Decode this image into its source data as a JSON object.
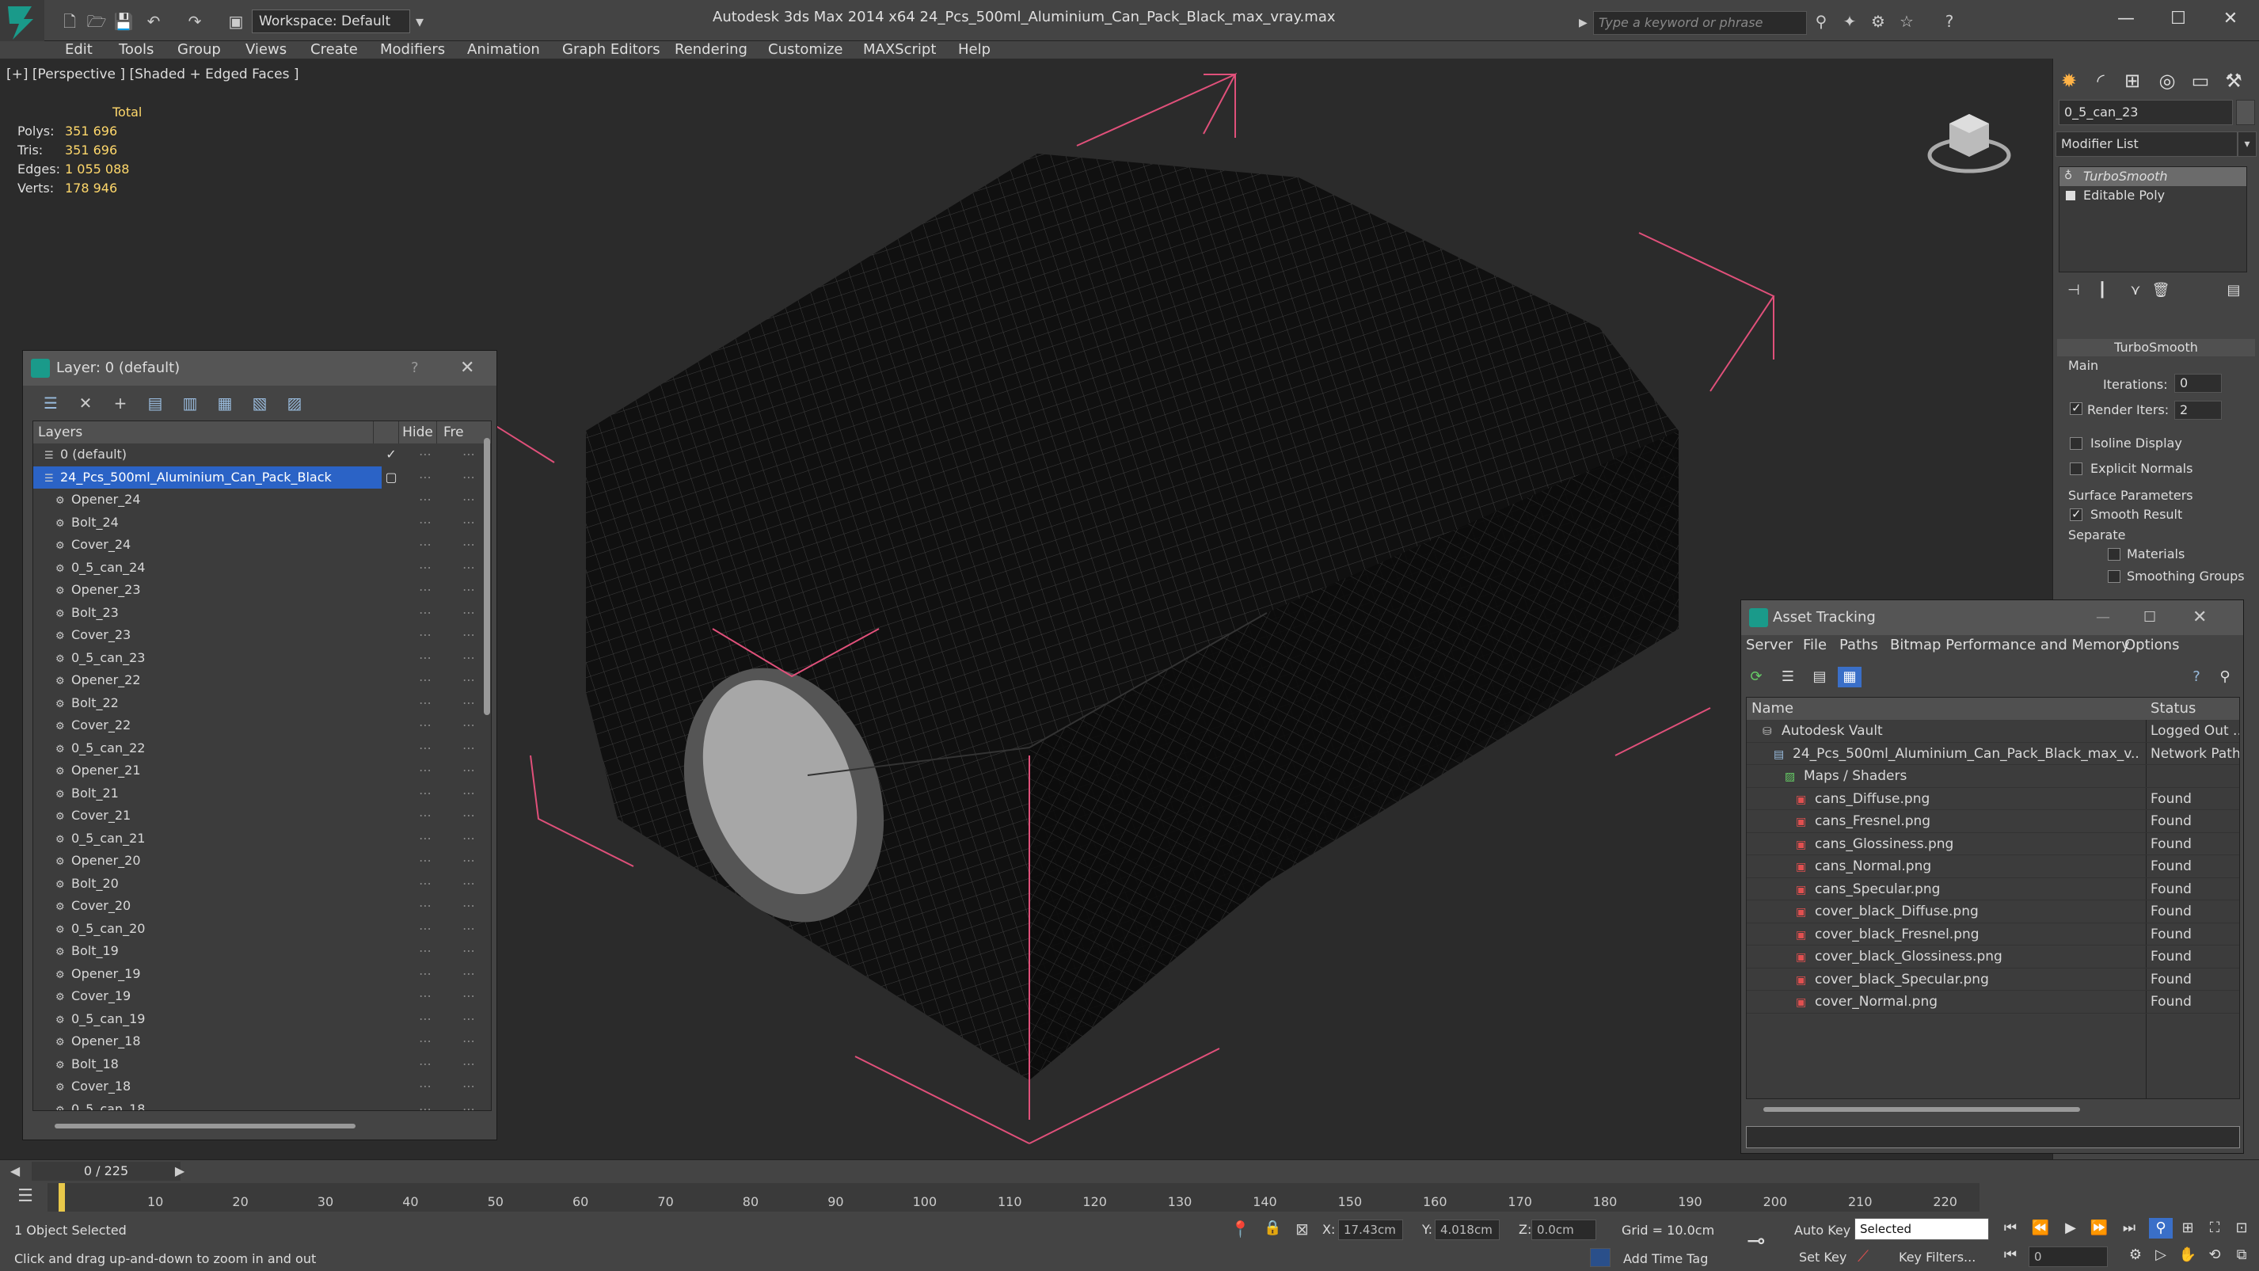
{
  "app": {
    "title": "Autodesk 3ds Max  2014 x64     24_Pcs_500ml_Aluminium_Can_Pack_Black_max_vray.max",
    "workspace": "Workspace: Default",
    "search_placeholder": "Type a keyword or phrase"
  },
  "menu": [
    "Edit",
    "Tools",
    "Group",
    "Views",
    "Create",
    "Modifiers",
    "Animation",
    "Graph Editors",
    "Rendering",
    "Customize",
    "MAXScript",
    "Help"
  ],
  "viewport": {
    "label": "[+] [Perspective ] [Shaded + Edged Faces ]",
    "stats": {
      "header": "Total",
      "rows": [
        {
          "key": "Polys:",
          "value": "351 696"
        },
        {
          "key": "Tris:",
          "value": "351 696"
        },
        {
          "key": "Edges:",
          "value": "1 055 088"
        },
        {
          "key": "Verts:",
          "value": "178 946"
        }
      ]
    }
  },
  "layer_window": {
    "title": "Layer: 0 (default)",
    "help": "?",
    "headers": {
      "layers": "Layers",
      "hide": "Hide",
      "freeze": "Fre"
    },
    "rows": [
      {
        "name": "0 (default)",
        "level": 1,
        "type": "layer",
        "current": true
      },
      {
        "name": "24_Pcs_500ml_Aluminium_Can_Pack_Black",
        "level": 1,
        "type": "layer",
        "selected": true
      },
      {
        "name": "Opener_24",
        "level": 2
      },
      {
        "name": "Bolt_24",
        "level": 2
      },
      {
        "name": "Cover_24",
        "level": 2
      },
      {
        "name": "0_5_can_24",
        "level": 2
      },
      {
        "name": "Opener_23",
        "level": 2
      },
      {
        "name": "Bolt_23",
        "level": 2
      },
      {
        "name": "Cover_23",
        "level": 2
      },
      {
        "name": "0_5_can_23",
        "level": 2
      },
      {
        "name": "Opener_22",
        "level": 2
      },
      {
        "name": "Bolt_22",
        "level": 2
      },
      {
        "name": "Cover_22",
        "level": 2
      },
      {
        "name": "0_5_can_22",
        "level": 2
      },
      {
        "name": "Opener_21",
        "level": 2
      },
      {
        "name": "Bolt_21",
        "level": 2
      },
      {
        "name": "Cover_21",
        "level": 2
      },
      {
        "name": "0_5_can_21",
        "level": 2
      },
      {
        "name": "Opener_20",
        "level": 2
      },
      {
        "name": "Bolt_20",
        "level": 2
      },
      {
        "name": "Cover_20",
        "level": 2
      },
      {
        "name": "0_5_can_20",
        "level": 2
      },
      {
        "name": "Bolt_19",
        "level": 2
      },
      {
        "name": "Opener_19",
        "level": 2
      },
      {
        "name": "Cover_19",
        "level": 2
      },
      {
        "name": "0_5_can_19",
        "level": 2
      },
      {
        "name": "Opener_18",
        "level": 2
      },
      {
        "name": "Bolt_18",
        "level": 2
      },
      {
        "name": "Cover_18",
        "level": 2
      },
      {
        "name": "0_5_can_18",
        "level": 2
      }
    ]
  },
  "command_panel": {
    "object_name": "0_5_can_23",
    "modifier_list": "Modifier List",
    "stack": [
      {
        "name": "TurboSmooth",
        "italic": true
      },
      {
        "name": "Editable Poly",
        "italic": false
      }
    ],
    "rollout_title": "TurboSmooth",
    "main_label": "Main",
    "iterations_label": "Iterations:",
    "iterations_value": "0",
    "render_iters_label": "Render Iters:",
    "render_iters_value": "2",
    "isoline_label": "Isoline Display",
    "explicit_normals_label": "Explicit Normals",
    "surface_params_label": "Surface Parameters",
    "smooth_result_label": "Smooth Result",
    "separate_label": "Separate",
    "materials_label": "Materials",
    "smoothing_groups_label": "Smoothing Groups"
  },
  "asset_tracking": {
    "title": "Asset Tracking",
    "menu": [
      "Server",
      "File",
      "Paths",
      "Bitmap Performance and Memory",
      "Options"
    ],
    "headers": {
      "name": "Name",
      "status": "Status"
    },
    "rows": [
      {
        "name": "Autodesk Vault",
        "status": "Logged Out ...",
        "level": 1,
        "icon": "vault"
      },
      {
        "name": "24_Pcs_500ml_Aluminium_Can_Pack_Black_max_v...",
        "status": "Network Path",
        "level": 2,
        "icon": "max"
      },
      {
        "name": "Maps / Shaders",
        "status": "",
        "level": 3,
        "icon": "maps"
      },
      {
        "name": "cans_Diffuse.png",
        "status": "Found",
        "level": 4,
        "icon": "png"
      },
      {
        "name": "cans_Fresnel.png",
        "status": "Found",
        "level": 4,
        "icon": "png"
      },
      {
        "name": "cans_Glossiness.png",
        "status": "Found",
        "level": 4,
        "icon": "png"
      },
      {
        "name": "cans_Normal.png",
        "status": "Found",
        "level": 4,
        "icon": "png"
      },
      {
        "name": "cans_Specular.png",
        "status": "Found",
        "level": 4,
        "icon": "png"
      },
      {
        "name": "cover_black_Diffuse.png",
        "status": "Found",
        "level": 4,
        "icon": "png"
      },
      {
        "name": "cover_black_Fresnel.png",
        "status": "Found",
        "level": 4,
        "icon": "png"
      },
      {
        "name": "cover_black_Glossiness.png",
        "status": "Found",
        "level": 4,
        "icon": "png"
      },
      {
        "name": "cover_black_Specular.png",
        "status": "Found",
        "level": 4,
        "icon": "png"
      },
      {
        "name": "cover_Normal.png",
        "status": "Found",
        "level": 4,
        "icon": "png"
      }
    ]
  },
  "timeline": {
    "frame_indicator": "0 / 225",
    "ticks": [
      "10",
      "20",
      "30",
      "40",
      "50",
      "60",
      "70",
      "80",
      "90",
      "100",
      "110",
      "120",
      "130",
      "140",
      "150",
      "160",
      "170",
      "180",
      "190",
      "200",
      "210",
      "220"
    ]
  },
  "status": {
    "selection": "1 Object Selected",
    "hint": "Click and drag up-and-down to zoom in and out",
    "x_label": "X:",
    "x_value": "17.43cm",
    "y_label": "Y:",
    "y_value": "4.018cm",
    "z_label": "Z:",
    "z_value": "0.0cm",
    "grid": "Grid = 10.0cm",
    "add_time_tag": "Add Time Tag",
    "auto_key": "Auto Key",
    "selected_dropdown": "Selected",
    "set_key": "Set Key",
    "key_filters": "Key Filters...",
    "frame_value": "0"
  },
  "colors": {
    "selection_blue": "#2b63c6",
    "stat_yellow": "#ffd86b",
    "bbox_pink": "#e0507a"
  }
}
